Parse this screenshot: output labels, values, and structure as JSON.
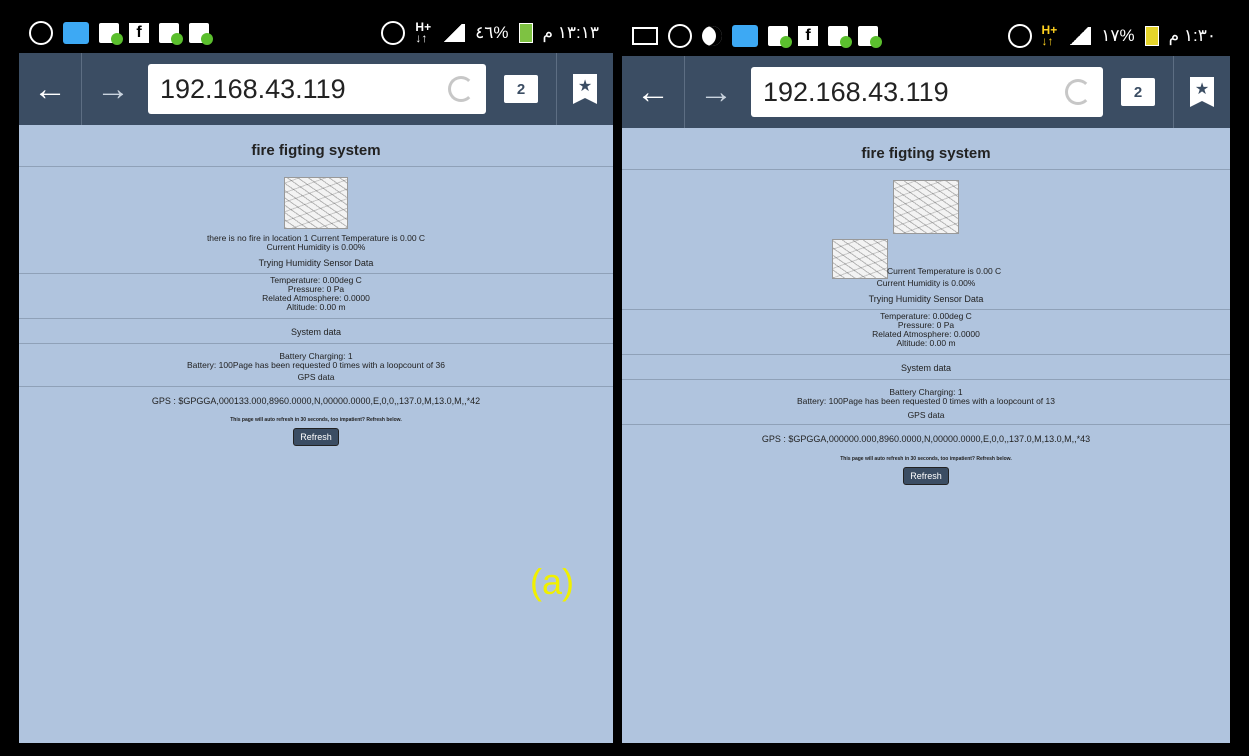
{
  "phones": [
    {
      "status_time": "١٣:١٣ م",
      "battery_pct": "٤٦%",
      "url": "192.168.43.119",
      "tab_count": "2",
      "page": {
        "title": "fire figting system",
        "fire_line": "there is no fire in location 1 Current Temperature is 0.00 C",
        "humidity_line": "Current Humidity is 0.00%",
        "sensor_heading": "Trying Humidity Sensor Data",
        "temperature": "Temperature: 0.00deg C",
        "pressure": "Pressure: 0 Pa",
        "atmosphere": "Related Atmosphere: 0.0000",
        "altitude": "Altitude: 0.00 m",
        "system_heading": "System data",
        "battery_charging": "Battery Charging: 1",
        "battery_line": "Battery: 100Page has been requested 0 times with a loopcount of 36",
        "gps_heading": "GPS data",
        "gps_line": "GPS : $GPGGA,000133.000,8960.0000,N,00000.0000,E,0,0,,137.0,M,13.0,M,,*42",
        "auto_refresh": "This page will auto refresh in 30 seconds, too impatient? Refresh below.",
        "refresh_label": "Refresh"
      }
    },
    {
      "status_time": "١:٣٠ م",
      "battery_pct": "١٧%",
      "url": "192.168.43.119",
      "tab_count": "2",
      "page": {
        "title": "fire figting system",
        "temp_line": "Current Temperature is 0.00 C",
        "humidity_line": "Current Humidity is 0.00%",
        "sensor_heading": "Trying Humidity Sensor Data",
        "temperature": "Temperature: 0.00deg C",
        "pressure": "Pressure: 0 Pa",
        "atmosphere": "Related Atmosphere: 0.0000",
        "altitude": "Altitude: 0.00 m",
        "system_heading": "System data",
        "battery_charging": "Battery Charging: 1",
        "battery_line": "Battery: 100Page has been requested 0 times with a loopcount of 13",
        "gps_heading": "GPS data",
        "gps_line": "GPS : $GPGGA,000000.000,8960.0000,N,00000.0000,E,0,0,,137.0,M,13.0,M,,*43",
        "auto_refresh": "This page will auto refresh in 30 seconds, too impatient? Refresh below.",
        "refresh_label": "Refresh"
      }
    }
  ],
  "caption": "(a)",
  "colors": {
    "page_bg": "#b0c4de",
    "toolbar": "#3b4d63",
    "caption": "#f0f000"
  }
}
